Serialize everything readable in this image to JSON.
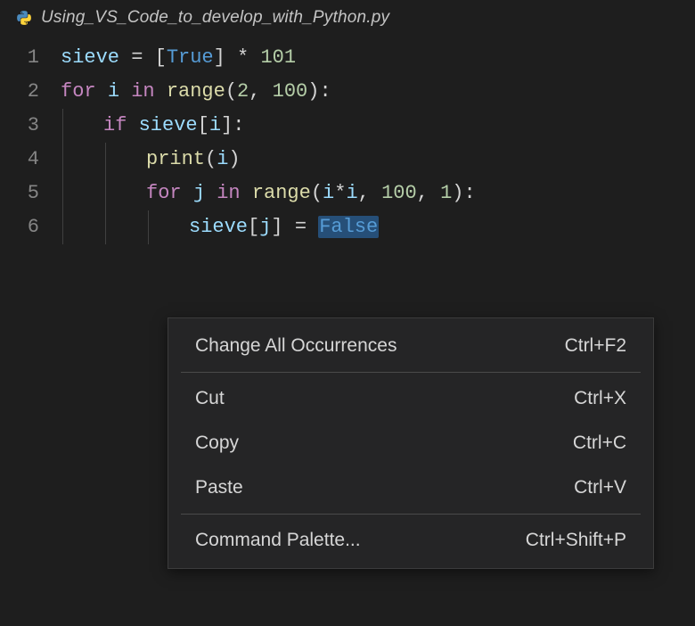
{
  "tab": {
    "filename": "Using_VS_Code_to_develop_with_Python.py",
    "icon": "python-icon"
  },
  "editor": {
    "lines": [
      {
        "num": "1",
        "indent": 0,
        "tokens": [
          {
            "t": "sieve",
            "c": "tk-var"
          },
          {
            "t": " ",
            "c": "tk-op"
          },
          {
            "t": "=",
            "c": "tk-op"
          },
          {
            "t": " ",
            "c": "tk-op"
          },
          {
            "t": "[",
            "c": "tk-punc"
          },
          {
            "t": "True",
            "c": "tk-const"
          },
          {
            "t": "]",
            "c": "tk-punc"
          },
          {
            "t": " ",
            "c": "tk-op"
          },
          {
            "t": "*",
            "c": "tk-op"
          },
          {
            "t": " ",
            "c": "tk-op"
          },
          {
            "t": "101",
            "c": "tk-num"
          }
        ]
      },
      {
        "num": "2",
        "indent": 0,
        "tokens": [
          {
            "t": "for",
            "c": "tk-kw"
          },
          {
            "t": " ",
            "c": "tk-op"
          },
          {
            "t": "i",
            "c": "tk-var"
          },
          {
            "t": " ",
            "c": "tk-op"
          },
          {
            "t": "in",
            "c": "tk-kw"
          },
          {
            "t": " ",
            "c": "tk-op"
          },
          {
            "t": "range",
            "c": "tk-fn"
          },
          {
            "t": "(",
            "c": "tk-punc"
          },
          {
            "t": "2",
            "c": "tk-num"
          },
          {
            "t": ",",
            "c": "tk-punc"
          },
          {
            "t": " ",
            "c": "tk-op"
          },
          {
            "t": "100",
            "c": "tk-num"
          },
          {
            "t": ")",
            "c": "tk-punc"
          },
          {
            "t": ":",
            "c": "tk-punc"
          }
        ]
      },
      {
        "num": "3",
        "indent": 1,
        "tokens": [
          {
            "t": "if",
            "c": "tk-kw"
          },
          {
            "t": " ",
            "c": "tk-op"
          },
          {
            "t": "sieve",
            "c": "tk-var"
          },
          {
            "t": "[",
            "c": "tk-punc"
          },
          {
            "t": "i",
            "c": "tk-var"
          },
          {
            "t": "]",
            "c": "tk-punc"
          },
          {
            "t": ":",
            "c": "tk-punc"
          }
        ]
      },
      {
        "num": "4",
        "indent": 2,
        "tokens": [
          {
            "t": "print",
            "c": "tk-fn"
          },
          {
            "t": "(",
            "c": "tk-punc"
          },
          {
            "t": "i",
            "c": "tk-var"
          },
          {
            "t": ")",
            "c": "tk-punc"
          }
        ]
      },
      {
        "num": "5",
        "indent": 2,
        "tokens": [
          {
            "t": "for",
            "c": "tk-kw"
          },
          {
            "t": " ",
            "c": "tk-op"
          },
          {
            "t": "j",
            "c": "tk-var"
          },
          {
            "t": " ",
            "c": "tk-op"
          },
          {
            "t": "in",
            "c": "tk-kw"
          },
          {
            "t": " ",
            "c": "tk-op"
          },
          {
            "t": "range",
            "c": "tk-fn"
          },
          {
            "t": "(",
            "c": "tk-punc"
          },
          {
            "t": "i",
            "c": "tk-var"
          },
          {
            "t": "*",
            "c": "tk-op"
          },
          {
            "t": "i",
            "c": "tk-var"
          },
          {
            "t": ",",
            "c": "tk-punc"
          },
          {
            "t": " ",
            "c": "tk-op"
          },
          {
            "t": "100",
            "c": "tk-num"
          },
          {
            "t": ",",
            "c": "tk-punc"
          },
          {
            "t": " ",
            "c": "tk-op"
          },
          {
            "t": "1",
            "c": "tk-num"
          },
          {
            "t": ")",
            "c": "tk-punc"
          },
          {
            "t": ":",
            "c": "tk-punc"
          }
        ]
      },
      {
        "num": "6",
        "indent": 3,
        "tokens": [
          {
            "t": "sieve",
            "c": "tk-var"
          },
          {
            "t": "[",
            "c": "tk-punc"
          },
          {
            "t": "j",
            "c": "tk-var"
          },
          {
            "t": "]",
            "c": "tk-punc"
          },
          {
            "t": " ",
            "c": "tk-op"
          },
          {
            "t": "=",
            "c": "tk-op"
          },
          {
            "t": " ",
            "c": "tk-op"
          },
          {
            "t": "False",
            "c": "tk-const",
            "sel": true
          }
        ]
      }
    ]
  },
  "contextMenu": {
    "groups": [
      [
        {
          "label": "Change All Occurrences",
          "shortcut": "Ctrl+F2"
        }
      ],
      [
        {
          "label": "Cut",
          "shortcut": "Ctrl+X"
        },
        {
          "label": "Copy",
          "shortcut": "Ctrl+C"
        },
        {
          "label": "Paste",
          "shortcut": "Ctrl+V"
        }
      ],
      [
        {
          "label": "Command Palette...",
          "shortcut": "Ctrl+Shift+P"
        }
      ]
    ]
  }
}
